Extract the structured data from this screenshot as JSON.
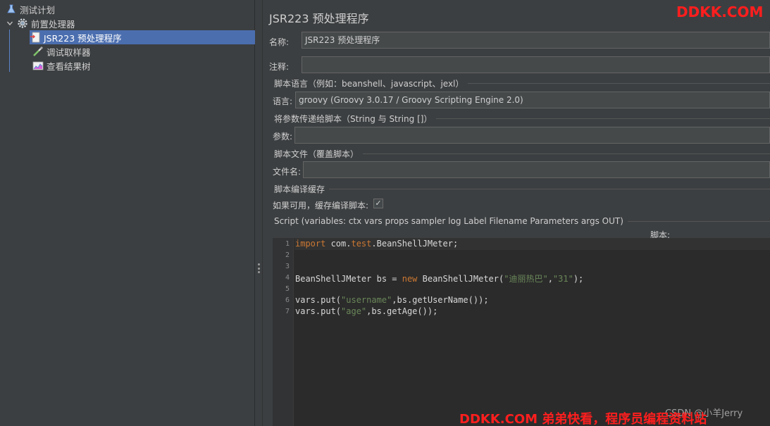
{
  "tree": {
    "items": [
      {
        "label": "测试计划",
        "icon": "flask-icon"
      },
      {
        "label": "前置处理器",
        "icon": "gear-icon"
      },
      {
        "label": "JSR223 预处理程序",
        "icon": "script-file-icon"
      },
      {
        "label": "调试取样器",
        "icon": "pipette-icon"
      },
      {
        "label": "查看结果树",
        "icon": "chart-tree-icon"
      }
    ]
  },
  "panel": {
    "title": "JSR223 预处理程序",
    "name_label": "名称:",
    "name_value": "JSR223 预处理程序",
    "comment_label": "注释:",
    "comment_value": "",
    "lang_section": "脚本语言（例如：beanshell、javascript、jexl）",
    "lang_label": "语言:",
    "lang_value": "groovy     (Groovy 3.0.17 / Groovy Scripting Engine 2.0)",
    "params_section": "将参数传递给脚本（String 与 String []）",
    "params_label": "参数:",
    "params_value": "",
    "file_section": "脚本文件（覆盖脚本）",
    "file_label": "文件名:",
    "file_value": "",
    "cache_section": "脚本编译缓存",
    "cache_label": "如果可用，缓存编译脚本:",
    "cache_checked": "✓",
    "script_section": "Script (variables: ctx vars props sampler log Label Filename Parameters args OUT)",
    "script_label": "脚本:"
  },
  "editor": {
    "line_numbers": [
      "1",
      "2",
      "3",
      "4",
      "5",
      "6",
      "7"
    ],
    "lines": {
      "l1_kw": "import",
      "l1_a": " com.",
      "l1_pk": "test",
      "l1_b": ".BeanShellJMeter;",
      "l4_a": "BeanShellJMeter bs = ",
      "l4_kw": "new",
      "l4_b": " BeanShellJMeter(",
      "l4_s1": "\"迪丽热巴\"",
      "l4_c": ",",
      "l4_s2": "\"31\"",
      "l4_d": ");",
      "l6_a": "vars.put(",
      "l6_s": "\"username\"",
      "l6_b": ",bs.getUserName());",
      "l7_a": "vars.put(",
      "l7_s": "\"age\"",
      "l7_b": ",bs.getAge());"
    }
  },
  "watermarks": {
    "top_right": "DDKK.COM",
    "bottom": "DDKK.COM 弟弟快看，程序员编程资料站",
    "csdn": "CSDN @小羊Jerry"
  },
  "colors": {
    "selection": "#4b6eaf",
    "keyword": "#cc7832",
    "string": "#6a8759",
    "watermark": "#ff1e1e"
  }
}
